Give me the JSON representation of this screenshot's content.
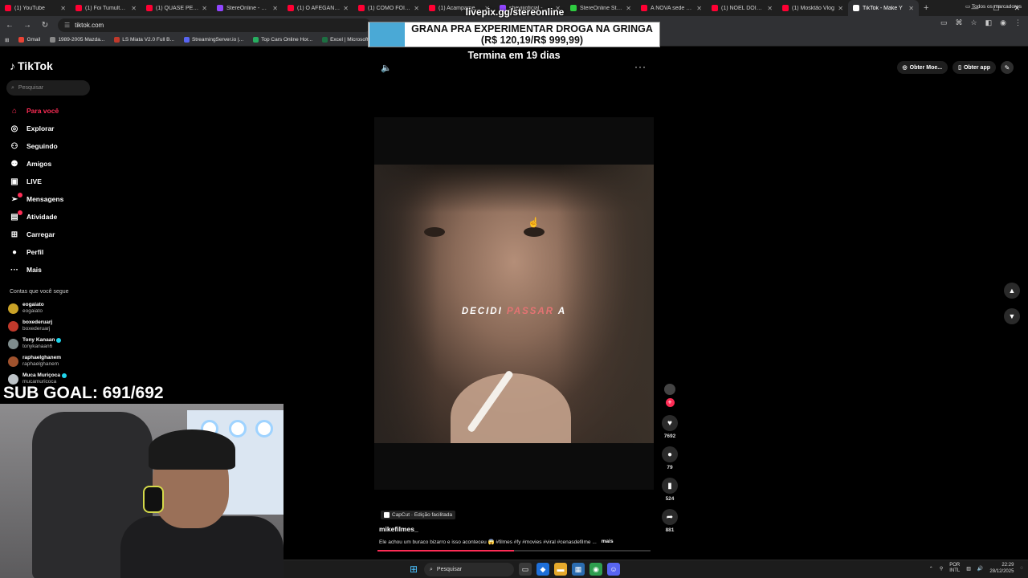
{
  "browser": {
    "tabs": [
      {
        "title": "(1) YouTube",
        "color": "#ff0033",
        "active": false
      },
      {
        "title": "(1) Foi Tumultuar p",
        "color": "#ff0033",
        "active": false
      },
      {
        "title": "(1) QUASE PERDI M",
        "color": "#ff0033",
        "active": false
      },
      {
        "title": "StereOnline - Twitch",
        "color": "#9146ff",
        "active": false
      },
      {
        "title": "(1) O AFEGANISTÃ",
        "color": "#ff0033",
        "active": false
      },
      {
        "title": "(1) COMO FOI TEU",
        "color": "#ff0033",
        "active": false
      },
      {
        "title": "(1) Acampamento",
        "color": "#ff0033",
        "active": false
      },
      {
        "title": "sheviiioficial - Twitc",
        "color": "#9146ff",
        "active": false
      },
      {
        "title": "StereOnline Stream",
        "color": "#2ecc40",
        "active": false
      },
      {
        "title": "A NOVA sede da e",
        "color": "#ff0033",
        "active": false
      },
      {
        "title": "(1) NOEL DOIDÃO",
        "color": "#ff0033",
        "active": false
      },
      {
        "title": "(1) Mosktão Vlog",
        "color": "#ff0033",
        "active": false
      },
      {
        "title": "TikTok - Make Y",
        "color": "#ffffff",
        "active": true
      }
    ],
    "url": "tiktok.com",
    "bookmarks": [
      {
        "label": "Gmail",
        "color": "#ea4335"
      },
      {
        "label": "1989-2005 Mazda...",
        "color": "#888888"
      },
      {
        "label": "LS Miata V2.0 Full B...",
        "color": "#c0392b"
      },
      {
        "label": "StreamingServer.io |...",
        "color": "#5865f2"
      },
      {
        "label": "Top Cars Online Hor...",
        "color": "#27ae60"
      },
      {
        "label": "Excel | Microsoft 365",
        "color": "#1d6f42"
      }
    ],
    "all_bookmarks": "Todos os marcadores"
  },
  "overlay": {
    "livepix": "livepix.gg/stereonline",
    "banner_line1": "GRANA PRA EXPERIMENTAR DROGA NA GRINGA",
    "banner_line2": "(R$ 120,19/R$ 999,99)",
    "ends": "Termina em 19 dias",
    "subgoal": "SUB GOAL: 691/692"
  },
  "tiktok": {
    "logo": "TikTok",
    "search_placeholder": "Pesquisar",
    "nav": [
      {
        "label": "Para você",
        "icon": "home-icon",
        "glyph": "⌂",
        "active": true,
        "badge": false
      },
      {
        "label": "Explorar",
        "icon": "compass-icon",
        "glyph": "◎",
        "active": false,
        "badge": false
      },
      {
        "label": "Seguindo",
        "icon": "following-icon",
        "glyph": "⚇",
        "active": false,
        "badge": false
      },
      {
        "label": "Amigos",
        "icon": "friends-icon",
        "glyph": "⚉",
        "active": false,
        "badge": false
      },
      {
        "label": "LIVE",
        "icon": "live-icon",
        "glyph": "▣",
        "active": false,
        "badge": false
      },
      {
        "label": "Mensagens",
        "icon": "messages-icon",
        "glyph": "➢",
        "active": false,
        "badge": true
      },
      {
        "label": "Atividade",
        "icon": "activity-icon",
        "glyph": "▤",
        "active": false,
        "badge": true
      },
      {
        "label": "Carregar",
        "icon": "upload-icon",
        "glyph": "⊞",
        "active": false,
        "badge": false
      },
      {
        "label": "Perfil",
        "icon": "profile-icon",
        "glyph": "●",
        "active": false,
        "badge": false
      },
      {
        "label": "Mais",
        "icon": "more-icon",
        "glyph": "···",
        "active": false,
        "badge": false
      }
    ],
    "following_title": "Contas que você segue",
    "following": [
      {
        "name": "eogaiato",
        "handle": "eogaiato",
        "verified": false,
        "color": "#c9a227"
      },
      {
        "name": "boxederuarj",
        "handle": "boxederuarj",
        "verified": false,
        "color": "#c0392b"
      },
      {
        "name": "Tony Kanaan",
        "handle": "tonykanaan6",
        "verified": true,
        "color": "#7f8c8d"
      },
      {
        "name": "raphaelghanem",
        "handle": "raphaelghanem",
        "verified": false,
        "color": "#a0522d"
      },
      {
        "name": "Muca Muriçoca",
        "handle": "mucamuricoca",
        "verified": true,
        "color": "#bdc3c7"
      }
    ],
    "top_right": {
      "coins": "Obter Moe...",
      "app": "Obter app"
    },
    "video": {
      "caption_a": "DECIDI",
      "caption_b": "PASSAR",
      "caption_c": "A",
      "capcut": "CapCut · Edição facilitada",
      "author": "mikefilmes_",
      "description": "Ele achou um buraco bizarro e isso aconteceu 😱 #filmes #fy #movies #viral #cenasdefilme ...",
      "more": "mais",
      "progress": 0.5,
      "likes": "7692",
      "comments": "79",
      "saves": "524",
      "shares": "881"
    }
  },
  "taskbar": {
    "search": "Pesquisar",
    "lang_line1": "POR",
    "lang_line2": "INTL",
    "time": "22:29",
    "date": "28/12/2025"
  }
}
